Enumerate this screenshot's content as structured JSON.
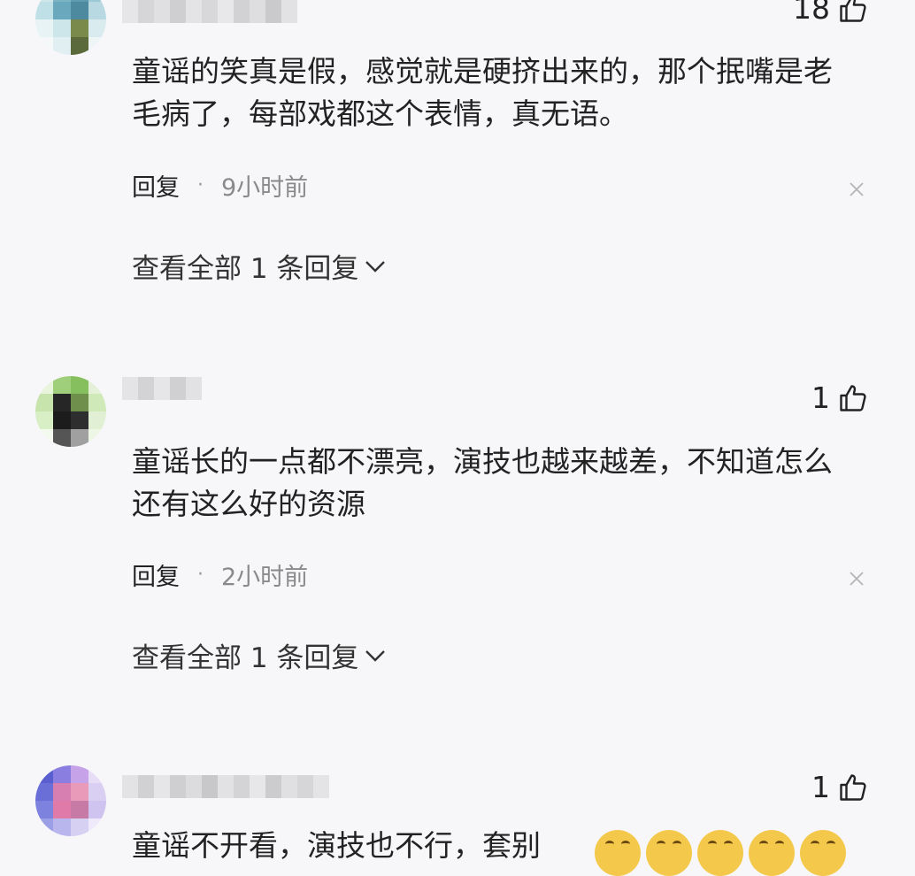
{
  "comments": [
    {
      "likes": "18",
      "text": "童谣的笑真是假，感觉就是硬挤出来的，那个抿嘴是老\n毛病了，每部戏都这个表情，真无语。",
      "reply_label": "回复",
      "time": "9小时前",
      "view_all": "查看全部 1 条回复"
    },
    {
      "likes": "1",
      "text": "童谣长的一点都不漂亮，演技也越来越差，不知道怎么\n还有这么好的资源",
      "reply_label": "回复",
      "time": "2小时前",
      "view_all": "查看全部 1 条回复"
    },
    {
      "likes": "1",
      "text": "童谣不开看，演技也不行，套别"
    }
  ],
  "icons": {
    "like": "thumbs-up-icon",
    "dismiss": "close-icon",
    "expand": "chevron-down-icon",
    "emoji": "grinning-face-emoji"
  },
  "colors": {
    "background": "#f7f7fa",
    "text": "#222222",
    "meta_time": "#8a8a8a",
    "emoji": "#f4c84a"
  }
}
